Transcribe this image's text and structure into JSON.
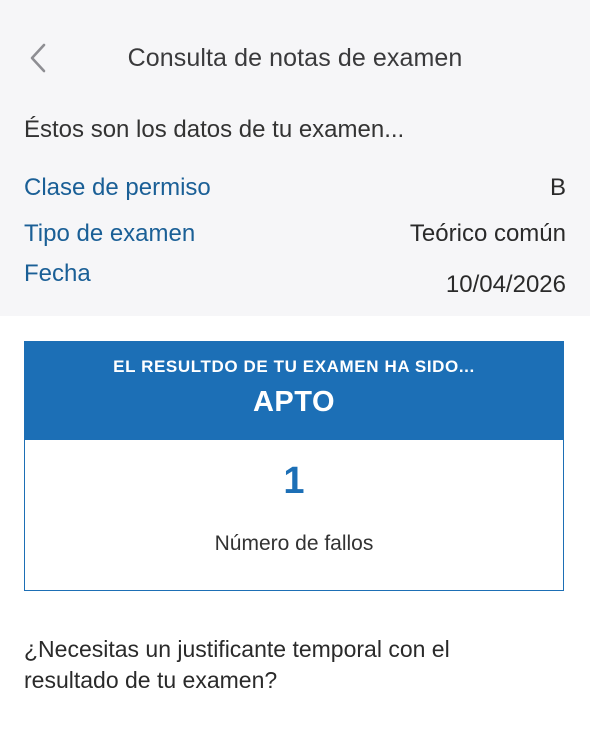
{
  "nav": {
    "title": "Consulta de notas de examen",
    "back_icon": "chevron-left-icon"
  },
  "intro": "Éstos son los datos de tu examen...",
  "details": [
    {
      "label": "Clase de permiso",
      "value": "B"
    },
    {
      "label": "Tipo de examen",
      "value": "Teórico común"
    },
    {
      "label": "Fecha",
      "value": "10/04/2026"
    }
  ],
  "result": {
    "caption": "EL RESULTDO DE TU EXAMEN HA SIDO...",
    "value": "APTO",
    "fails_count": "1",
    "fails_label": "Número de fallos"
  },
  "question": "¿Necesitas un justificante temporal con el resultado de tu examen?",
  "colors": {
    "accent": "#1c6fb6",
    "label_blue": "#1a5f96",
    "background_gray": "#f6f6f8"
  }
}
